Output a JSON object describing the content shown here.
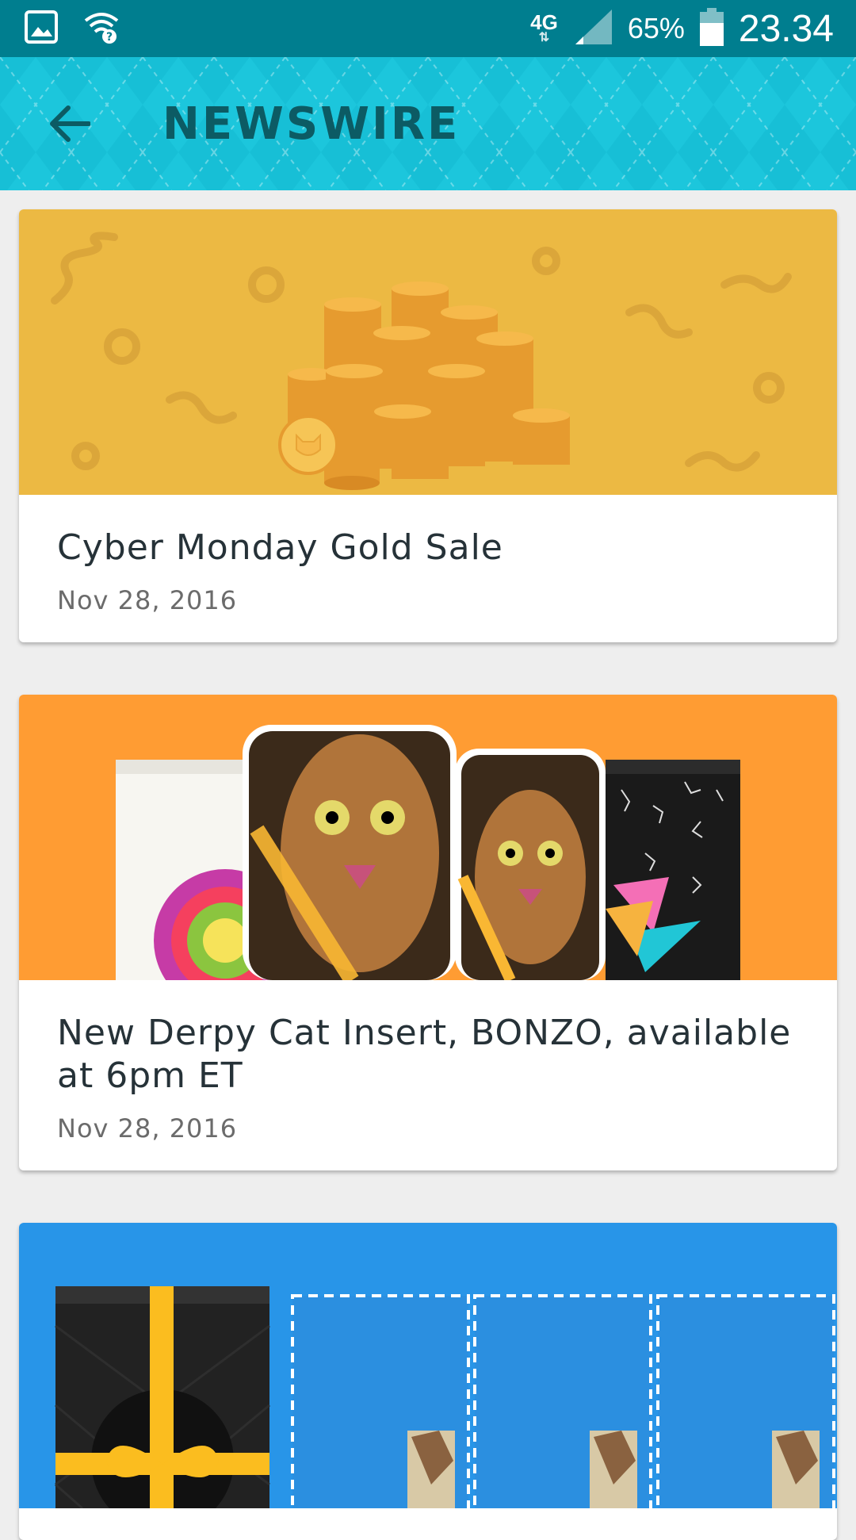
{
  "status_bar": {
    "network": "4G",
    "battery": "65%",
    "time": "23.34",
    "icons": [
      "image-icon",
      "wifi-question-icon",
      "signal-icon",
      "battery-icon"
    ]
  },
  "app_bar": {
    "title": "NEWSWIRE",
    "back_icon": "arrow-back-icon",
    "color": "#17bfd6"
  },
  "news": [
    {
      "title": "Cyber Monday Gold Sale",
      "date": "Nov 28, 2016",
      "hero_color": "#ecb943",
      "image": "gold-coins-illustration"
    },
    {
      "title": "New Derpy Cat Insert, BONZO, available at 6pm ET",
      "date": "Nov 28, 2016",
      "hero_color": "#ff9c33",
      "image": "cat-insert-packs-illustration"
    },
    {
      "title": "",
      "date": "",
      "hero_color": "#2895e8",
      "image": "gift-pack-illustration"
    }
  ]
}
